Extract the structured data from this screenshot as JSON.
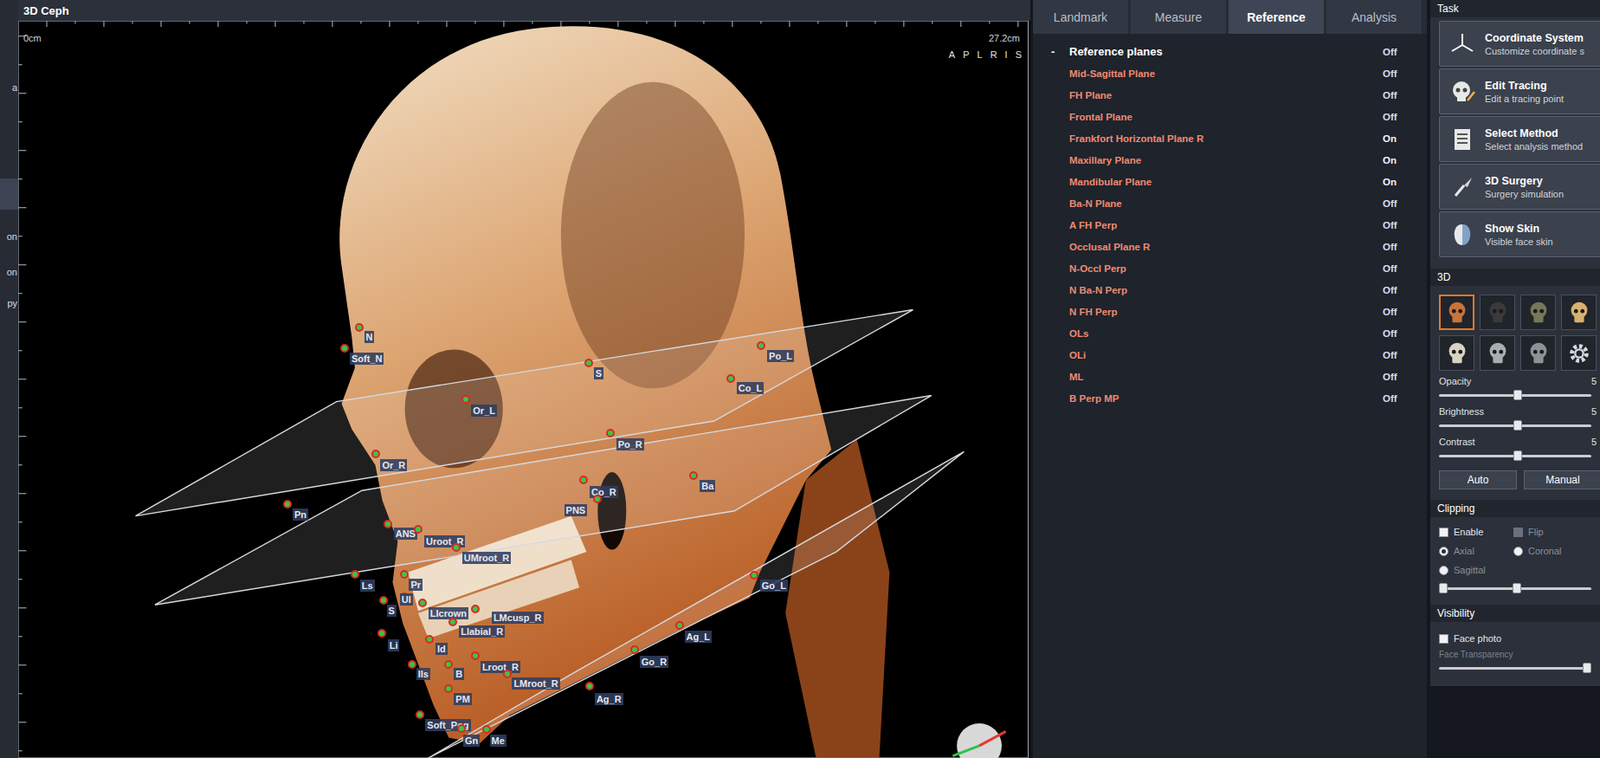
{
  "left_strip": {
    "items": [
      {
        "label": "a",
        "selected": false
      },
      {
        "label": "",
        "selected": true
      },
      {
        "label": "on",
        "selected": false
      },
      {
        "label": "on",
        "selected": false
      },
      {
        "label": "py",
        "selected": false
      }
    ]
  },
  "viewport": {
    "title": "3D Ceph",
    "ruler": {
      "start": "0cm",
      "end": "27.2cm"
    },
    "view_buttons": [
      "A",
      "P",
      "L",
      "R",
      "I",
      "S"
    ],
    "landmarks": [
      {
        "label": "N"
      },
      {
        "label": "Soft_N"
      },
      {
        "label": "Or_L"
      },
      {
        "label": "S"
      },
      {
        "label": "Po_L"
      },
      {
        "label": "Co_L"
      },
      {
        "label": "Or_R"
      },
      {
        "label": "Po_R"
      },
      {
        "label": "Pn"
      },
      {
        "label": "Ba"
      },
      {
        "label": "Co_R"
      },
      {
        "label": "PNS"
      },
      {
        "label": "ANS"
      },
      {
        "label": "Uroot_R"
      },
      {
        "label": "UMroot_R"
      },
      {
        "label": "Ls"
      },
      {
        "label": "Pr"
      },
      {
        "label": "Go_L"
      },
      {
        "label": "S"
      },
      {
        "label": "UI"
      },
      {
        "label": "LIcrown"
      },
      {
        "label": "LMcusp_R"
      },
      {
        "label": "Llabial_R"
      },
      {
        "label": "Li"
      },
      {
        "label": "Id"
      },
      {
        "label": "Ag_L"
      },
      {
        "label": "Lroot_R"
      },
      {
        "label": "Go_R"
      },
      {
        "label": "LMroot_R"
      },
      {
        "label": "Ils"
      },
      {
        "label": "B"
      },
      {
        "label": "PM"
      },
      {
        "label": "Ag_R"
      },
      {
        "label": "Soft_Pog"
      },
      {
        "label": "Gn"
      },
      {
        "label": "Me"
      }
    ]
  },
  "tabs": [
    {
      "label": "Landmark",
      "selected": false
    },
    {
      "label": "Measure",
      "selected": false
    },
    {
      "label": "Reference",
      "selected": true
    },
    {
      "label": "Analysis",
      "selected": false
    }
  ],
  "reference_planes": {
    "toggle": "-",
    "label": "Reference planes",
    "value": "Off",
    "expanded": true,
    "items": [
      {
        "label": "Mid-Sagittal Plane",
        "value": "Off",
        "on": false
      },
      {
        "label": "FH Plane",
        "value": "Off",
        "on": false
      },
      {
        "label": "Frontal Plane",
        "value": "Off",
        "on": false
      },
      {
        "label": "Frankfort Horizontal Plane R",
        "value": "On",
        "on": true
      },
      {
        "label": "Maxillary Plane",
        "value": "On",
        "on": true
      },
      {
        "label": "Mandibular Plane",
        "value": "On",
        "on": true
      },
      {
        "label": "Ba-N Plane",
        "value": "Off",
        "on": false
      },
      {
        "label": "A FH Perp",
        "value": "Off",
        "on": false
      },
      {
        "label": "Occlusal Plane R",
        "value": "Off",
        "on": false
      },
      {
        "label": "N-Occl Perp",
        "value": "Off",
        "on": false
      },
      {
        "label": "N Ba-N Perp",
        "value": "Off",
        "on": false
      },
      {
        "label": "N FH Perp",
        "value": "Off",
        "on": false
      },
      {
        "label": "OLs",
        "value": "Off",
        "on": false
      },
      {
        "label": "OLi",
        "value": "Off",
        "on": false
      },
      {
        "label": "ML",
        "value": "Off",
        "on": false
      },
      {
        "label": "B Perp MP",
        "value": "Off",
        "on": false
      }
    ]
  },
  "task": {
    "title": "Task",
    "buttons": [
      {
        "title": "Coordinate System",
        "subtitle": "Customize coordinate s"
      },
      {
        "title": "Edit Tracing",
        "subtitle": "Edit a tracing point"
      },
      {
        "title": "Select Method",
        "subtitle": "Select analysis method"
      },
      {
        "title": "3D Surgery",
        "subtitle": "Surgery simulation"
      },
      {
        "title": "Show Skin",
        "subtitle": "Visible face skin"
      }
    ]
  },
  "view_3d": {
    "title": "3D",
    "presets": [
      {
        "kind": "skull",
        "selected": true
      },
      {
        "kind": "skull",
        "selected": false
      },
      {
        "kind": "skull",
        "selected": false
      },
      {
        "kind": "skull",
        "selected": false
      },
      {
        "kind": "skull",
        "selected": false
      },
      {
        "kind": "skull",
        "selected": false
      },
      {
        "kind": "skull",
        "selected": false
      },
      {
        "kind": "settings",
        "selected": false
      }
    ],
    "sliders": [
      {
        "label": "Opacity",
        "level": 0.52,
        "reading": "5"
      },
      {
        "label": "Brightness",
        "level": 0.52,
        "reading": "5"
      },
      {
        "label": "Contrast",
        "level": 0.52,
        "reading": "5"
      }
    ],
    "buttons": [
      "Auto",
      "Manual"
    ]
  },
  "clipping": {
    "title": "Clipping",
    "checkboxes": [
      {
        "label": "Enable",
        "checked": false,
        "disabled": false
      },
      {
        "label": "Flip",
        "checked": false,
        "disabled": true
      }
    ],
    "radios": [
      {
        "label": "Axial",
        "selected": true,
        "disabled": true
      },
      {
        "label": "Coronal",
        "selected": false,
        "disabled": true
      },
      {
        "label": "Sagittal",
        "selected": false,
        "disabled": true
      }
    ],
    "range": {
      "low": 0,
      "high": 0.51
    }
  },
  "visibility": {
    "title": "Visibility",
    "face_photo": {
      "label": "Face photo",
      "checked": false
    },
    "transparency": {
      "label": "Face Transparency",
      "level": 1,
      "disabled": true
    }
  }
}
